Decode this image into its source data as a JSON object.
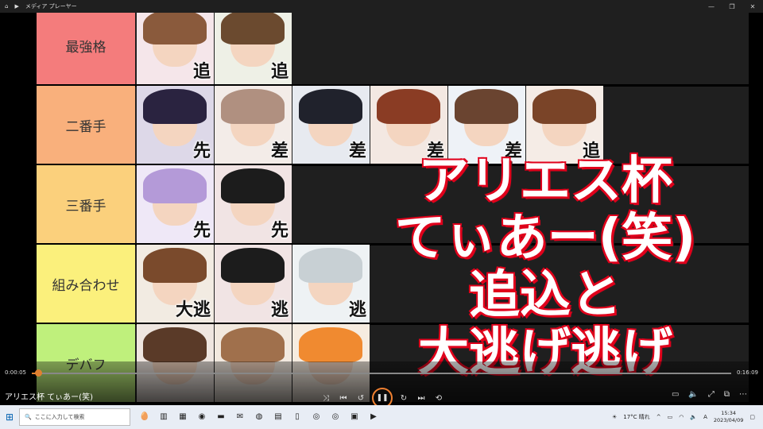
{
  "window": {
    "title": "メディア プレーヤー",
    "controls": [
      "—",
      "❐",
      "✕"
    ]
  },
  "tiers": [
    {
      "label": "最強格",
      "color": "#f47c7c",
      "cells": [
        {
          "tag": "追",
          "hair": "#8a5a3c",
          "bg": "#f5e6ea"
        },
        {
          "tag": "追",
          "hair": "#6b4a2f",
          "bg": "#eef0e6"
        }
      ]
    },
    {
      "label": "二番手",
      "color": "#f9b07c",
      "cells": [
        {
          "tag": "先",
          "hair": "#2a2340",
          "bg": "#ddd8e8"
        },
        {
          "tag": "差",
          "hair": "#b09080",
          "bg": "#f3ece8"
        },
        {
          "tag": "差",
          "hair": "#20222c",
          "bg": "#e7eaf0"
        },
        {
          "tag": "差",
          "hair": "#8a3c24",
          "bg": "#f3e8e2"
        },
        {
          "tag": "差",
          "hair": "#6a4430",
          "bg": "#eef2f7"
        },
        {
          "tag": "追",
          "hair": "#7a4428",
          "bg": "#f5ece6"
        }
      ]
    },
    {
      "label": "三番手",
      "color": "#fbd07c",
      "cells": [
        {
          "tag": "先",
          "hair": "#b49ad8",
          "bg": "#efe8f7"
        },
        {
          "tag": "先",
          "hair": "#1c1c1c",
          "bg": "#f1e4e4"
        }
      ]
    },
    {
      "label": "組み合わせ",
      "color": "#fbf07c",
      "cells": [
        {
          "tag": "大逃",
          "hair": "#7a4a2c",
          "bg": "#f2ebe2"
        },
        {
          "tag": "逃",
          "hair": "#1c1c1c",
          "bg": "#f1e4e4"
        },
        {
          "tag": "逃",
          "hair": "#c8d0d4",
          "bg": "#eef2f4"
        }
      ]
    },
    {
      "label": "デバフ",
      "color": "#bff07c",
      "cells": [
        {
          "tag": "",
          "hair": "#5a3a28",
          "bg": "#efe6e0"
        },
        {
          "tag": "",
          "hair": "#a0704c",
          "bg": "#f2e9df"
        },
        {
          "tag": "",
          "hair": "#f08a30",
          "bg": "#f6ece0"
        }
      ]
    }
  ],
  "overlay_lines": [
    "アリエス杯",
    "てぃあー(笑)",
    "追込と",
    "大逃げ逃げ"
  ],
  "player": {
    "title": "アリエス杯 てぃあー(笑)",
    "current_time": "0:00:05",
    "total_time": "0:16:09",
    "progress": 0.005,
    "accent": "#f08030"
  },
  "taskbar": {
    "search_placeholder": "ここに入力して検索",
    "weather": "17°C  晴れ",
    "ime": "A",
    "time": "15:34",
    "date": "2023/04/09"
  }
}
